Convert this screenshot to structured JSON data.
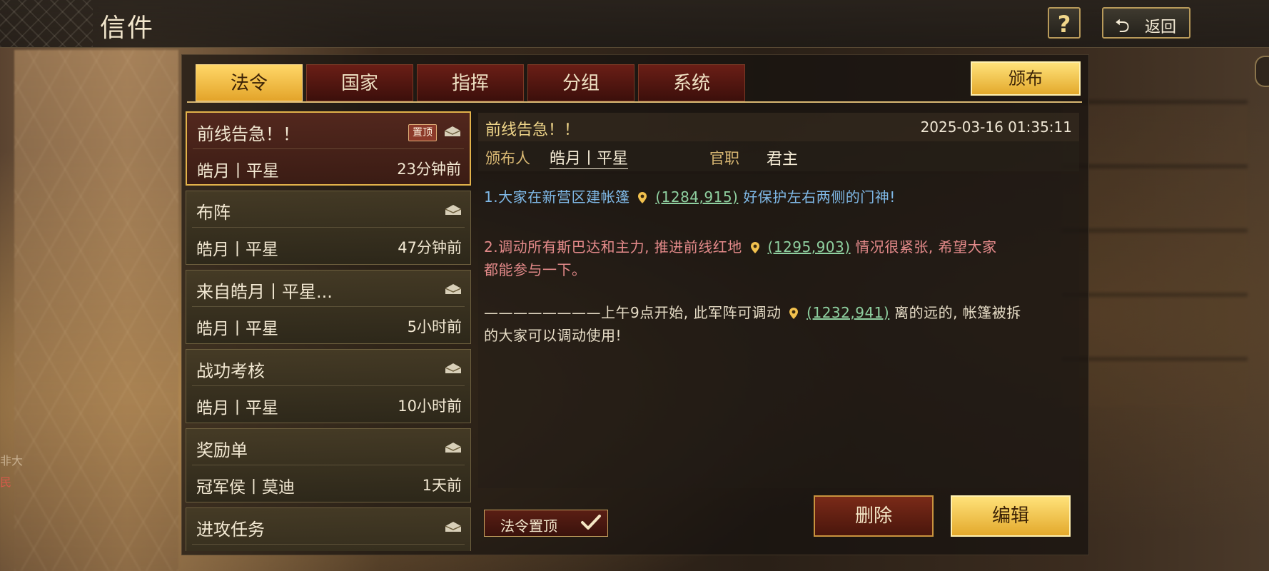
{
  "window": {
    "title": "信件"
  },
  "top_buttons": {
    "help_label": "?",
    "back_label": "返回"
  },
  "tabs": [
    {
      "label": "法令",
      "active": true
    },
    {
      "label": "国家",
      "active": false
    },
    {
      "label": "指挥",
      "active": false
    },
    {
      "label": "分组",
      "active": false
    },
    {
      "label": "系统",
      "active": false
    }
  ],
  "publish_label": "颁布",
  "letters": [
    {
      "subject": "前线告急！！",
      "sender": "皓月丨平星",
      "time": "23分钟前",
      "pinned_badge": "置顶",
      "icon": "envelope-open-icon"
    },
    {
      "subject": "布阵",
      "sender": "皓月丨平星",
      "time": "47分钟前",
      "icon": "envelope-open-icon"
    },
    {
      "subject": "来自皓月丨平星...",
      "sender": "皓月丨平星",
      "time": "5小时前",
      "icon": "envelope-open-icon"
    },
    {
      "subject": "战功考核",
      "sender": "皓月丨平星",
      "time": "10小时前",
      "icon": "envelope-open-icon"
    },
    {
      "subject": "奖励单",
      "sender": "冠军侯丨莫迪",
      "time": "1天前",
      "icon": "envelope-open-icon"
    },
    {
      "subject": "进攻任务",
      "sender": "",
      "time": "",
      "icon": "envelope-open-icon"
    }
  ],
  "detail": {
    "subject": "前线告急！！",
    "timestamp": "2025-03-16 01:35:11",
    "publisher_label": "颁布人",
    "publisher": "皓月丨平星",
    "office_label": "官职",
    "office": "君主",
    "body": {
      "line1_before": "1.大家在新营区建帐篷",
      "line1_coord": "(1284,915)",
      "line1_after": "好保护左右两侧的门神!",
      "line2_before": "2.调动所有斯巴达和主力, 推进前线红地",
      "line2_coord": "(1295,903)",
      "line2_after": "情况很紧张, 希望大家",
      "line3": "都能参与一下。",
      "line4_before": "————————上午9点开始, 此军阵可调动",
      "line4_coord": "(1232,941)",
      "line4_after": "离的远的, 帐篷被拆",
      "line5": "的大家可以调动使用!"
    }
  },
  "pin_toggle": {
    "label": "法令置顶",
    "checked": true
  },
  "delete_label": "删除",
  "edit_label": "编辑",
  "edge_text": {
    "fragment1": "非大",
    "fragment2": "民"
  },
  "colors": {
    "gold": "#e3a92c",
    "dark_red": "#4a160c",
    "blue_text": "#7fb8e6",
    "red_text": "#e48a8a",
    "coord_green": "#8fd0a0"
  }
}
